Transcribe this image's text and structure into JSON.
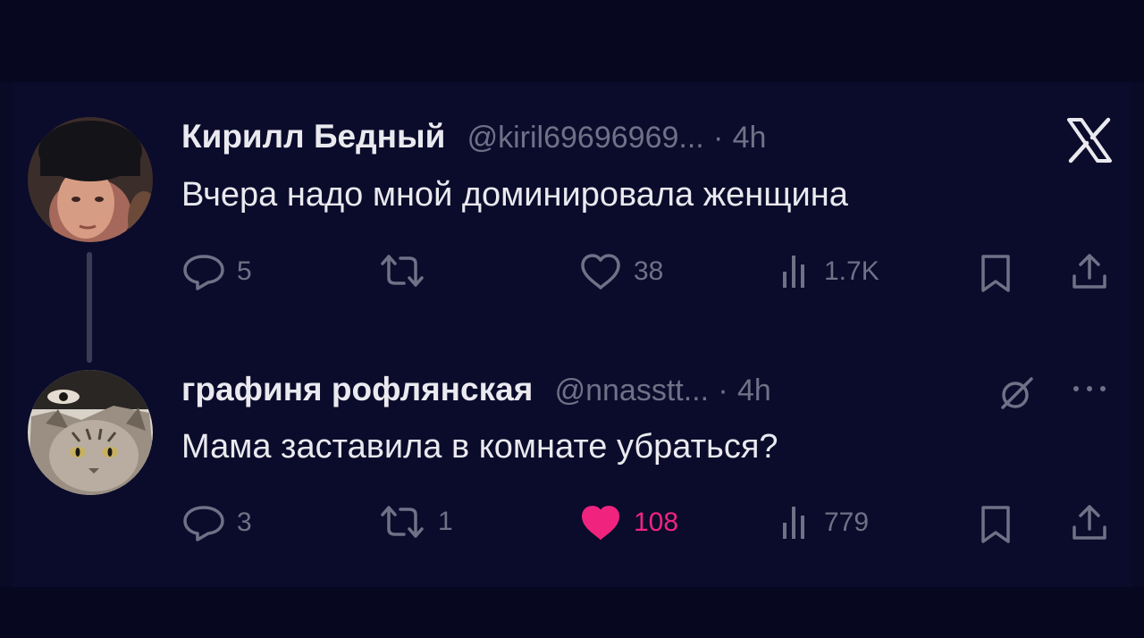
{
  "tweets": [
    {
      "display_name": "Кирилл Бедный",
      "handle": "@kiril69696969...",
      "separator": "·",
      "time": "4h",
      "text": "Вчера надо мной доминировала женщина",
      "stats": {
        "replies": "5",
        "reposts": "",
        "likes": "38",
        "views": "1.7K"
      },
      "liked": false
    },
    {
      "display_name": "графиня рофлянская",
      "handle": "@nnasstt...",
      "separator": "·",
      "time": "4h",
      "text": "Мама заставила в комнате убраться?",
      "stats": {
        "replies": "3",
        "reposts": "1",
        "likes": "108",
        "views": "779"
      },
      "liked": true
    }
  ],
  "icons": {
    "brand": "x-logo-icon",
    "reply": "reply-icon",
    "repost": "repost-icon",
    "like": "heart-icon",
    "views": "views-bar-chart-icon",
    "bookmark": "bookmark-icon",
    "share": "share-icon",
    "grok": "grok-icon",
    "more": "more-icon"
  },
  "colors": {
    "background": "#0b0b2b",
    "text_primary": "#e9e9ef",
    "text_secondary": "#6f7187",
    "like_active": "#f0247f",
    "thread_line": "#3a3c56"
  }
}
